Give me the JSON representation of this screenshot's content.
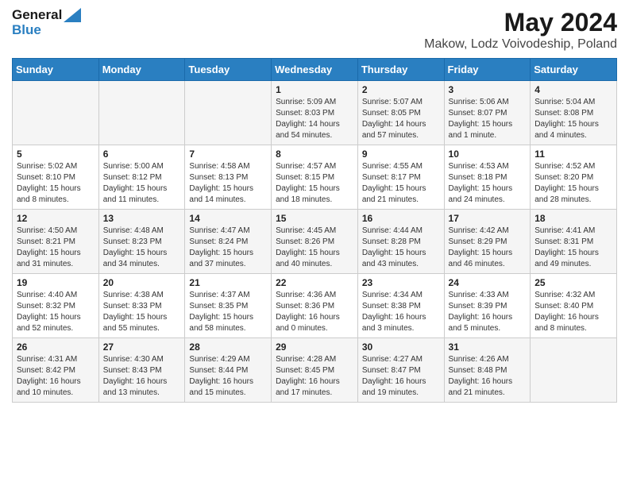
{
  "header": {
    "logo_line1": "General",
    "logo_line2": "Blue",
    "month_year": "May 2024",
    "location": "Makow, Lodz Voivodeship, Poland"
  },
  "days_of_week": [
    "Sunday",
    "Monday",
    "Tuesday",
    "Wednesday",
    "Thursday",
    "Friday",
    "Saturday"
  ],
  "weeks": [
    [
      {
        "day": "",
        "info": ""
      },
      {
        "day": "",
        "info": ""
      },
      {
        "day": "",
        "info": ""
      },
      {
        "day": "1",
        "info": "Sunrise: 5:09 AM\nSunset: 8:03 PM\nDaylight: 14 hours\nand 54 minutes."
      },
      {
        "day": "2",
        "info": "Sunrise: 5:07 AM\nSunset: 8:05 PM\nDaylight: 14 hours\nand 57 minutes."
      },
      {
        "day": "3",
        "info": "Sunrise: 5:06 AM\nSunset: 8:07 PM\nDaylight: 15 hours\nand 1 minute."
      },
      {
        "day": "4",
        "info": "Sunrise: 5:04 AM\nSunset: 8:08 PM\nDaylight: 15 hours\nand 4 minutes."
      }
    ],
    [
      {
        "day": "5",
        "info": "Sunrise: 5:02 AM\nSunset: 8:10 PM\nDaylight: 15 hours\nand 8 minutes."
      },
      {
        "day": "6",
        "info": "Sunrise: 5:00 AM\nSunset: 8:12 PM\nDaylight: 15 hours\nand 11 minutes."
      },
      {
        "day": "7",
        "info": "Sunrise: 4:58 AM\nSunset: 8:13 PM\nDaylight: 15 hours\nand 14 minutes."
      },
      {
        "day": "8",
        "info": "Sunrise: 4:57 AM\nSunset: 8:15 PM\nDaylight: 15 hours\nand 18 minutes."
      },
      {
        "day": "9",
        "info": "Sunrise: 4:55 AM\nSunset: 8:17 PM\nDaylight: 15 hours\nand 21 minutes."
      },
      {
        "day": "10",
        "info": "Sunrise: 4:53 AM\nSunset: 8:18 PM\nDaylight: 15 hours\nand 24 minutes."
      },
      {
        "day": "11",
        "info": "Sunrise: 4:52 AM\nSunset: 8:20 PM\nDaylight: 15 hours\nand 28 minutes."
      }
    ],
    [
      {
        "day": "12",
        "info": "Sunrise: 4:50 AM\nSunset: 8:21 PM\nDaylight: 15 hours\nand 31 minutes."
      },
      {
        "day": "13",
        "info": "Sunrise: 4:48 AM\nSunset: 8:23 PM\nDaylight: 15 hours\nand 34 minutes."
      },
      {
        "day": "14",
        "info": "Sunrise: 4:47 AM\nSunset: 8:24 PM\nDaylight: 15 hours\nand 37 minutes."
      },
      {
        "day": "15",
        "info": "Sunrise: 4:45 AM\nSunset: 8:26 PM\nDaylight: 15 hours\nand 40 minutes."
      },
      {
        "day": "16",
        "info": "Sunrise: 4:44 AM\nSunset: 8:28 PM\nDaylight: 15 hours\nand 43 minutes."
      },
      {
        "day": "17",
        "info": "Sunrise: 4:42 AM\nSunset: 8:29 PM\nDaylight: 15 hours\nand 46 minutes."
      },
      {
        "day": "18",
        "info": "Sunrise: 4:41 AM\nSunset: 8:31 PM\nDaylight: 15 hours\nand 49 minutes."
      }
    ],
    [
      {
        "day": "19",
        "info": "Sunrise: 4:40 AM\nSunset: 8:32 PM\nDaylight: 15 hours\nand 52 minutes."
      },
      {
        "day": "20",
        "info": "Sunrise: 4:38 AM\nSunset: 8:33 PM\nDaylight: 15 hours\nand 55 minutes."
      },
      {
        "day": "21",
        "info": "Sunrise: 4:37 AM\nSunset: 8:35 PM\nDaylight: 15 hours\nand 58 minutes."
      },
      {
        "day": "22",
        "info": "Sunrise: 4:36 AM\nSunset: 8:36 PM\nDaylight: 16 hours\nand 0 minutes."
      },
      {
        "day": "23",
        "info": "Sunrise: 4:34 AM\nSunset: 8:38 PM\nDaylight: 16 hours\nand 3 minutes."
      },
      {
        "day": "24",
        "info": "Sunrise: 4:33 AM\nSunset: 8:39 PM\nDaylight: 16 hours\nand 5 minutes."
      },
      {
        "day": "25",
        "info": "Sunrise: 4:32 AM\nSunset: 8:40 PM\nDaylight: 16 hours\nand 8 minutes."
      }
    ],
    [
      {
        "day": "26",
        "info": "Sunrise: 4:31 AM\nSunset: 8:42 PM\nDaylight: 16 hours\nand 10 minutes."
      },
      {
        "day": "27",
        "info": "Sunrise: 4:30 AM\nSunset: 8:43 PM\nDaylight: 16 hours\nand 13 minutes."
      },
      {
        "day": "28",
        "info": "Sunrise: 4:29 AM\nSunset: 8:44 PM\nDaylight: 16 hours\nand 15 minutes."
      },
      {
        "day": "29",
        "info": "Sunrise: 4:28 AM\nSunset: 8:45 PM\nDaylight: 16 hours\nand 17 minutes."
      },
      {
        "day": "30",
        "info": "Sunrise: 4:27 AM\nSunset: 8:47 PM\nDaylight: 16 hours\nand 19 minutes."
      },
      {
        "day": "31",
        "info": "Sunrise: 4:26 AM\nSunset: 8:48 PM\nDaylight: 16 hours\nand 21 minutes."
      },
      {
        "day": "",
        "info": ""
      }
    ]
  ]
}
